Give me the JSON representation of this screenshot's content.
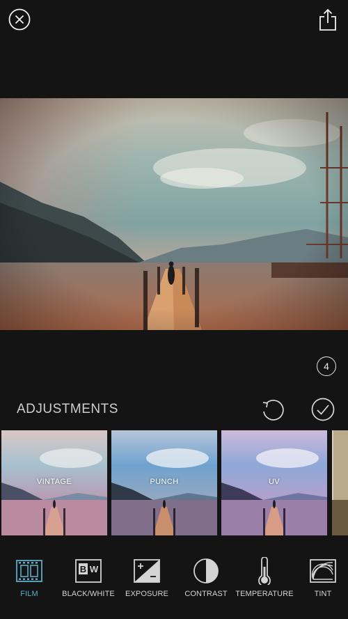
{
  "header": {
    "close_icon": "close-circle-icon",
    "share_icon": "share-icon"
  },
  "badge": {
    "count": "4"
  },
  "adjustments": {
    "title": "ADJUSTMENTS",
    "undo_icon": "undo-icon",
    "confirm_icon": "checkmark-icon"
  },
  "presets": [
    {
      "label": "VINTAGE"
    },
    {
      "label": "PUNCH"
    },
    {
      "label": "UV"
    }
  ],
  "tools": [
    {
      "label": "FILM",
      "icon": "film-icon",
      "active": true
    },
    {
      "label": "BLACK/WHITE",
      "icon": "bw-icon"
    },
    {
      "label": "EXPOSURE",
      "icon": "exposure-icon"
    },
    {
      "label": "CONTRAST",
      "icon": "contrast-icon"
    },
    {
      "label": "TEMPERATURE",
      "icon": "thermometer-icon"
    },
    {
      "label": "TINT",
      "icon": "tint-icon"
    }
  ],
  "colors": {
    "accent": "#5aaec8",
    "background": "#141414"
  }
}
